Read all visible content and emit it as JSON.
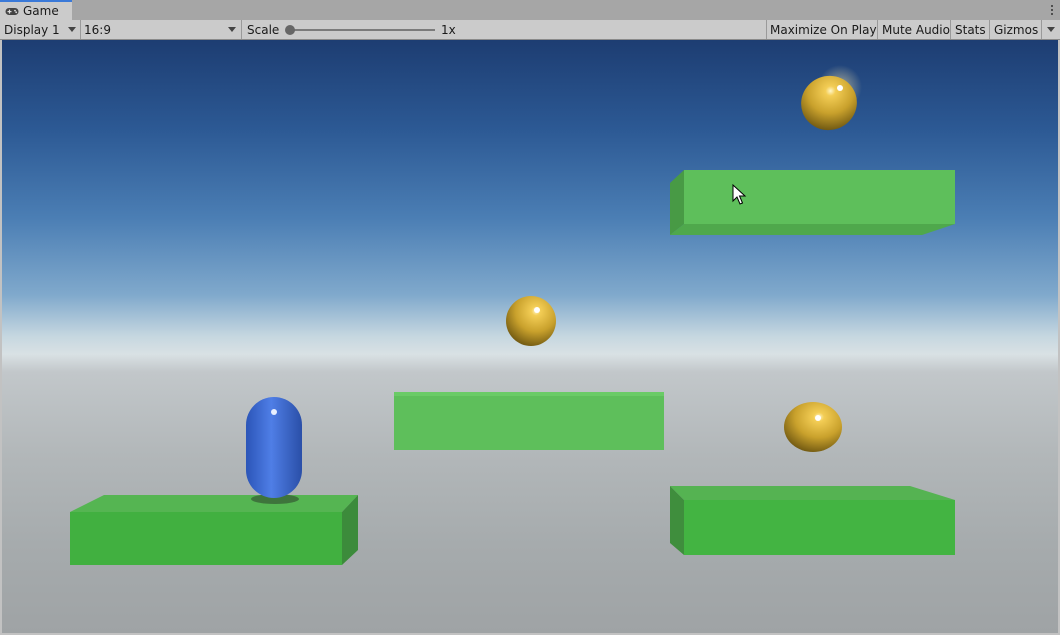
{
  "tab": {
    "title": "Game",
    "icon": "gamepad-icon"
  },
  "toolbar": {
    "display": "Display 1",
    "aspect": "16:9",
    "scale_label": "Scale",
    "scale_value": "1x",
    "maximize_on_play": "Maximize On Play",
    "mute_audio": "Mute Audio",
    "stats": "Stats",
    "gizmos": "Gizmos"
  },
  "scene": {
    "sky_color": "#2c5994",
    "ground_color": "#b2b7b9",
    "platform_color": "#5dbd5a",
    "player_color": "#3f6fd6",
    "coin_color": "#c9a12c"
  }
}
